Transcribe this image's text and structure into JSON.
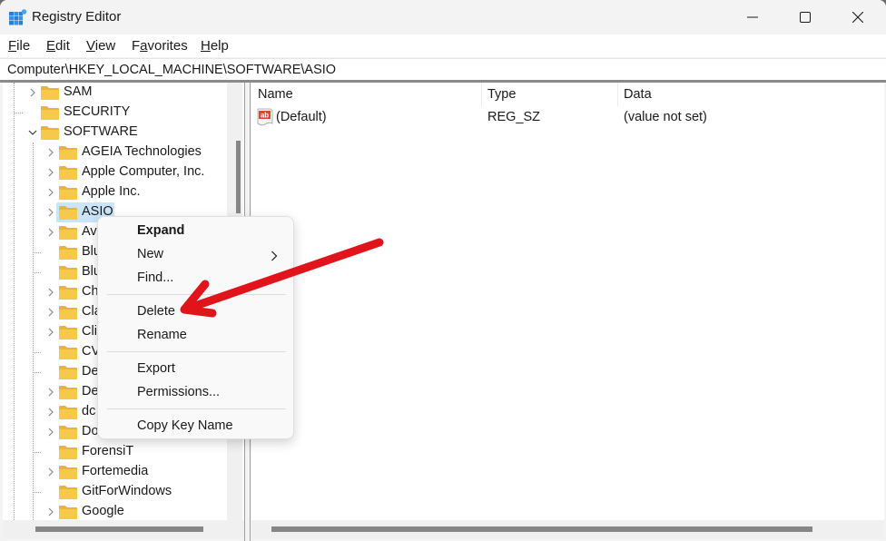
{
  "window": {
    "title": "Registry Editor",
    "controls": {
      "minimize": "minimize-icon",
      "maximize": "maximize-icon",
      "close": "close-icon"
    }
  },
  "menubar": {
    "items": [
      {
        "label": "File",
        "accel": "F",
        "rest": "ile"
      },
      {
        "label": "Edit",
        "accel": "E",
        "rest": "dit"
      },
      {
        "label": "View",
        "accel": "V",
        "rest": "iew"
      },
      {
        "label": "Favorites",
        "pre": "F",
        "accel": "a",
        "rest": "vorites"
      },
      {
        "label": "Help",
        "accel": "H",
        "rest": "elp"
      }
    ]
  },
  "address": {
    "path": "Computer\\HKEY_LOCAL_MACHINE\\SOFTWARE\\ASIO"
  },
  "tree": {
    "items": [
      {
        "label": "SAM",
        "level": 1,
        "expander": "collapsed"
      },
      {
        "label": "SECURITY",
        "level": 1,
        "expander": "none"
      },
      {
        "label": "SOFTWARE",
        "level": 1,
        "expander": "expanded"
      },
      {
        "label": "AGEIA Technologies",
        "level": 2,
        "expander": "collapsed"
      },
      {
        "label": "Apple Computer, Inc.",
        "level": 2,
        "expander": "collapsed"
      },
      {
        "label": "Apple Inc.",
        "level": 2,
        "expander": "collapsed"
      },
      {
        "label": "ASIO",
        "level": 2,
        "expander": "collapsed",
        "selected": true
      },
      {
        "label": "Av",
        "level": 2,
        "expander": "collapsed"
      },
      {
        "label": "Blu",
        "level": 2,
        "expander": "none"
      },
      {
        "label": "Blu",
        "level": 2,
        "expander": "none"
      },
      {
        "label": "Ch",
        "level": 2,
        "expander": "collapsed"
      },
      {
        "label": "Cla",
        "level": 2,
        "expander": "collapsed"
      },
      {
        "label": "Cli",
        "level": 2,
        "expander": "collapsed"
      },
      {
        "label": "CV",
        "level": 2,
        "expander": "none"
      },
      {
        "label": "De",
        "level": 2,
        "expander": "none"
      },
      {
        "label": "De",
        "level": 2,
        "expander": "collapsed"
      },
      {
        "label": "dc",
        "level": 2,
        "expander": "collapsed"
      },
      {
        "label": "Do",
        "level": 2,
        "expander": "collapsed"
      },
      {
        "label": "ForensiT",
        "level": 2,
        "expander": "none"
      },
      {
        "label": "Fortemedia",
        "level": 2,
        "expander": "collapsed"
      },
      {
        "label": "GitForWindows",
        "level": 2,
        "expander": "none"
      },
      {
        "label": "Google",
        "level": 2,
        "expander": "collapsed"
      }
    ]
  },
  "list": {
    "columns": [
      "Name",
      "Type",
      "Data"
    ],
    "rows": [
      {
        "icon": "string-value-icon",
        "name": "(Default)",
        "type": "REG_SZ",
        "data": "(value not set)"
      }
    ]
  },
  "context_menu": {
    "groups": [
      [
        {
          "label": "Expand",
          "bold": true
        },
        {
          "label": "New",
          "submenu": true
        },
        {
          "label": "Find..."
        }
      ],
      [
        {
          "label": "Delete"
        },
        {
          "label": "Rename"
        }
      ],
      [
        {
          "label": "Export"
        },
        {
          "label": "Permissions..."
        }
      ],
      [
        {
          "label": "Copy Key Name"
        }
      ]
    ]
  },
  "annotation": {
    "type": "arrow",
    "points_to": "Delete",
    "color": "#e0141a"
  },
  "colors": {
    "selection": "#cce4f7",
    "folder": "#f6c94a",
    "scroll_thumb": "#868686"
  }
}
